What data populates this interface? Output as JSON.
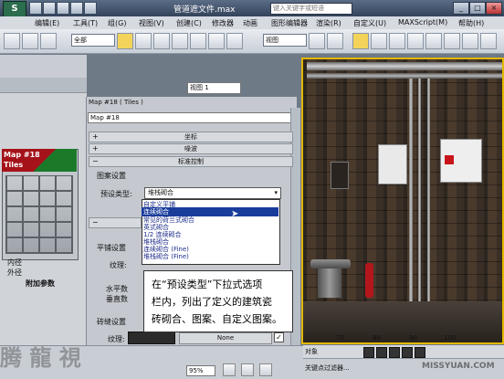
{
  "titlebar": {
    "document": "管道遮文件.max",
    "search_placeholder": "键入关键字或短语"
  },
  "menubar": {
    "items": [
      "编辑(E)",
      "工具(T)",
      "组(G)",
      "视图(V)",
      "创建(C)",
      "修改器",
      "动画",
      "图形编辑器",
      "渲染(R)",
      "自定义(U)",
      "MAXScript(M)",
      "帮助(H)"
    ]
  },
  "toolbar": {
    "filter_select": "全部",
    "view_select": "视图"
  },
  "viewport_tab": "视图 1",
  "material": {
    "header": "Map #18  ( Tiles )",
    "name_field": "Map #18",
    "thumb_title": "Map #18",
    "thumb_subtitle": "Tiles",
    "rollouts": [
      "坐标",
      "噪波",
      "标准控制"
    ],
    "group_label": "图案设置",
    "preset_label": "预设类型:",
    "preset_value": "堆栈砌合",
    "preset_options": [
      "自定义平铺",
      "连续砌合",
      "常见的荷兰式砌合",
      "英式砌合",
      "1/2 连续砌合",
      "堆栈砌合",
      "连续砌合 (Fine)",
      "堆栈砌合 (Fine)"
    ],
    "highlighted_option": 1,
    "left_labels": [
      "内径",
      "外径",
      "附加参数"
    ],
    "tile_settings_label": "平铺设置",
    "texture_label": "纹理:",
    "horizontal_label": "水平数",
    "vertical_label": "垂直数",
    "grout_label": "砖缝设置",
    "grout_texture_label": "纹理:",
    "none_label": "None"
  },
  "callout": {
    "lines": [
      "在“预设类型”下拉式选项",
      "栏内，列出了定义的建筑瓷",
      "砖砌合、图案、自定义图案。"
    ]
  },
  "statusbar": {
    "zoom": "95%",
    "object_label": "对象",
    "ruler": [
      "70",
      "80",
      "90",
      "100"
    ],
    "filter_label": "关键点过滤器...",
    "watermark": "MISSYUAN.COM"
  }
}
